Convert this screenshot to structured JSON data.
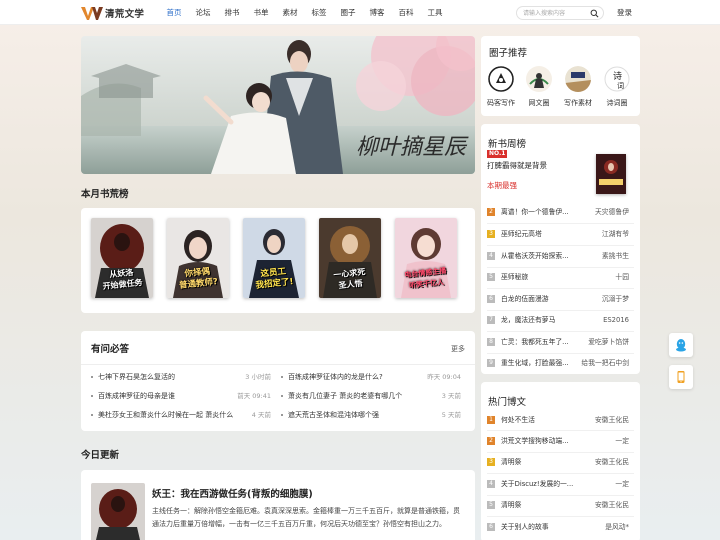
{
  "header": {
    "logo_text": "清荒文学",
    "nav": [
      "首页",
      "论坛",
      "排书",
      "书单",
      "素材",
      "标签",
      "圈子",
      "博客",
      "百科",
      "工具"
    ],
    "search_placeholder": "请输入搜索内容",
    "login": "登录"
  },
  "banner": {
    "caption": "柳叶摘星辰"
  },
  "month_rank": {
    "title": "本月书荒榜",
    "books": [
      {
        "cover_text": "从妖洛\n开始做任务"
      },
      {
        "cover_text": "你择偶\n普通教师?"
      },
      {
        "cover_text": "这员工\n我招定了!"
      },
      {
        "cover_text": "一心求死\n圣人悟"
      },
      {
        "cover_text": "电台情感主播\n听笑千亿人"
      }
    ]
  },
  "qa": {
    "title": "有问必答",
    "more": "更多",
    "items": [
      {
        "text": "七神下界石昊怎么复活的",
        "time": "3 小时前"
      },
      {
        "text": "百练成神罗征体内的龙是什么?",
        "time": "昨天 09:04"
      },
      {
        "text": "百炼成神罗征的母亲是谁",
        "time": "前天 09:41"
      },
      {
        "text": "萧炎有几位妻子 萧炎的老婆有哪几个",
        "time": "3 天前"
      },
      {
        "text": "美杜莎女王和萧炎什么时候在一起 萧炎什么",
        "time": "4 天前"
      },
      {
        "text": "遮天荒古圣体和混沌体哪个强",
        "time": "5 天前"
      }
    ]
  },
  "today": {
    "title": "今日更新",
    "book_name": "妖王：我在西游做任务(背叛的细胞膜)",
    "desc": "主线任务一：解除孙悟空金箍厄难。袁真深深思索。金箍棒重一万三千五百斤，就算是普通铁箍，贯通法力后重量万倍增幅，一击有一亿三千五百万斤重，何况后天功德至宝？孙悟空有担山之力。"
  },
  "circle": {
    "title": "圈子推荐",
    "items": [
      "码客写作",
      "网文圈",
      "写作素材",
      "诗词圈"
    ]
  },
  "weekly": {
    "title": "新书周榜",
    "no1_badge": "NO.1",
    "top_book": "打脾霸得就是背景",
    "top_tag": "本期最强",
    "list": [
      {
        "n": "2",
        "name": "离谱！你一个德鲁伊...",
        "author": "天灾德鲁伊"
      },
      {
        "n": "3",
        "name": "巫师纪元高塔",
        "author": "江湖有爷"
      },
      {
        "n": "4",
        "name": "从霍格沃茨开始探索...",
        "author": "素挑书生"
      },
      {
        "n": "5",
        "name": "巫师秘旅",
        "author": "十园"
      },
      {
        "n": "6",
        "name": "白龙的伍面漫游",
        "author": "沉溺于梦"
      },
      {
        "n": "7",
        "name": "龙，魔法还有萝马",
        "author": "ES2016"
      },
      {
        "n": "8",
        "name": "亡灵：我都死五年了...",
        "author": "爱吃萝卜馅饼"
      },
      {
        "n": "9",
        "name": "重生化域，打脸最强...",
        "author": "给我一把石中剑"
      }
    ]
  },
  "hot": {
    "title": "热门博文",
    "list": [
      {
        "n": "1",
        "name": "何处不生活",
        "author": "安徽王化民"
      },
      {
        "n": "2",
        "name": "洪荒文学搜狗移动端...",
        "author": "一定"
      },
      {
        "n": "3",
        "name": "清明祭",
        "author": "安徽王化民"
      },
      {
        "n": "4",
        "name": "关于Discuz!发展的一...",
        "author": "一定"
      },
      {
        "n": "5",
        "name": "清明祭",
        "author": "安徽王化民"
      },
      {
        "n": "6",
        "name": "关于别人的故事",
        "author": "是风动*"
      }
    ]
  },
  "colors": {
    "accent": "#2e6fc9",
    "rank_top": "#d9302c",
    "rank_2": "#e0842b",
    "rank_3": "#e6b021"
  }
}
